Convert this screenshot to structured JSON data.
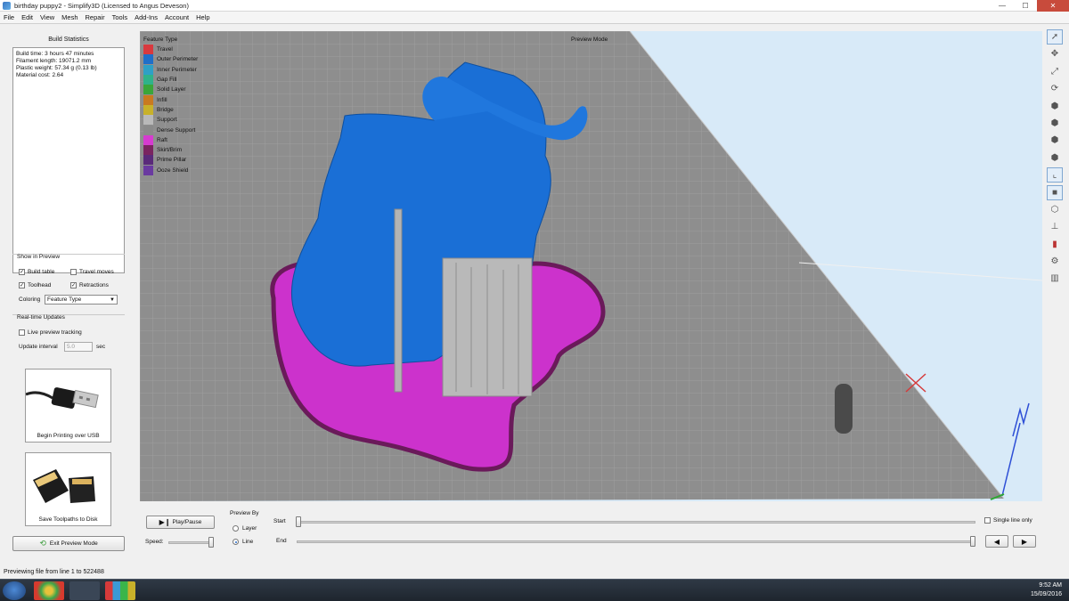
{
  "window": {
    "title": "birthday puppy2 - Simplify3D (Licensed to Angus Deveson)",
    "controls": [
      "—",
      "☐",
      "✕"
    ]
  },
  "menu": [
    "File",
    "Edit",
    "View",
    "Mesh",
    "Repair",
    "Tools",
    "Add-Ins",
    "Account",
    "Help"
  ],
  "build_statistics": {
    "heading": "Build Statistics",
    "lines": [
      "Build time: 3 hours 47 minutes",
      "Filament length: 19071.2 mm",
      "Plastic weight: 57.34 g (0.13 lb)",
      "Material cost: 2.64"
    ]
  },
  "show_in_preview": {
    "title": "Show in Preview",
    "build_table": "Build table",
    "travel_moves": "Travel moves",
    "toolhead": "Toolhead",
    "retractions": "Retractions",
    "coloring_label": "Coloring",
    "coloring_value": "Feature Type"
  },
  "realtime": {
    "title": "Real-time Updates",
    "live_tracking": "Live preview tracking",
    "interval_label": "Update interval",
    "interval_value": "5.0",
    "interval_unit": "sec"
  },
  "actions": {
    "usb": "Begin Printing over USB",
    "disk": "Save Toolpaths to Disk",
    "exit": "Exit Preview Mode"
  },
  "legend": {
    "title": "Feature Type",
    "items": [
      {
        "label": "Travel",
        "color": "#d9393e"
      },
      {
        "label": "Outer Perimeter",
        "color": "#1f6fc9"
      },
      {
        "label": "Inner Perimeter",
        "color": "#2ea0c6"
      },
      {
        "label": "Gap Fill",
        "color": "#2fb28a"
      },
      {
        "label": "Solid Layer",
        "color": "#3aa63a"
      },
      {
        "label": "Infill",
        "color": "#c97a20"
      },
      {
        "label": "Bridge",
        "color": "#c8b12a"
      },
      {
        "label": "Support",
        "color": "#b9b9b9"
      },
      {
        "label": "Dense Support",
        "color": "#8a8a8a"
      },
      {
        "label": "Raft",
        "color": "#d63bd0"
      },
      {
        "label": "Skirt/Brim",
        "color": "#7a2460"
      },
      {
        "label": "Prime Pillar",
        "color": "#5a2a7a"
      },
      {
        "label": "Ooze Shield",
        "color": "#6a3aa0"
      }
    ]
  },
  "viewport": {
    "mode_label": "Preview Mode"
  },
  "playback": {
    "play_pause": "Play/Pause",
    "speed_label": "Speed:",
    "preview_by": "Preview By",
    "layer": "Layer",
    "line": "Line",
    "start_label": "Start",
    "end_label": "End",
    "single_line": "Single line only"
  },
  "status": "Previewing file from line 1 to 522488",
  "clock": {
    "time": "9:52 AM",
    "date": "15/09/2016"
  }
}
